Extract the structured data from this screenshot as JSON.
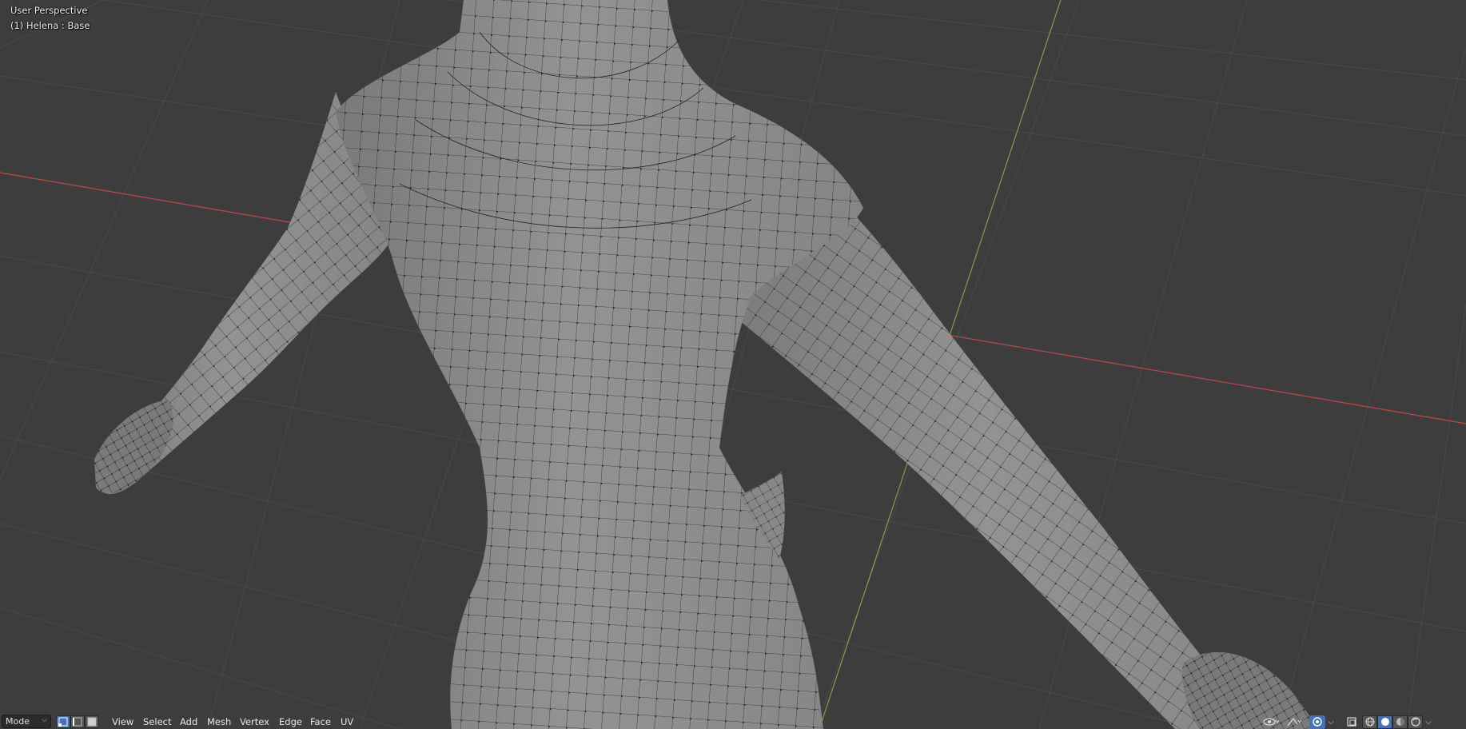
{
  "viewport": {
    "perspective_label": "User Perspective",
    "object_label": "(1) Helena : Base",
    "colors": {
      "background": "#3d3d3d",
      "grid": "#4a4a4a",
      "x_axis": "#c0484b",
      "y_axis": "#7fa33a",
      "mesh_fill": "#8a8a8a",
      "mesh_wire": "#1f1f1f",
      "vertex": "#111111"
    }
  },
  "header": {
    "mode_label": "Mode",
    "select_modes": [
      "vertex-select-icon",
      "edge-select-icon",
      "face-select-icon"
    ],
    "active_select_mode": 0,
    "menus": [
      "View",
      "Select",
      "Add",
      "Mesh",
      "Vertex",
      "Edge",
      "Face",
      "UV"
    ],
    "right_icons": [
      "visibility-icon",
      "gizmo-icon",
      "overlay-icon",
      "xray-icon",
      "wireframe-shading-icon",
      "solid-shading-icon",
      "material-shading-icon",
      "rendered-shading-icon"
    ],
    "active_shading": 1,
    "accent": "#4772b3"
  }
}
